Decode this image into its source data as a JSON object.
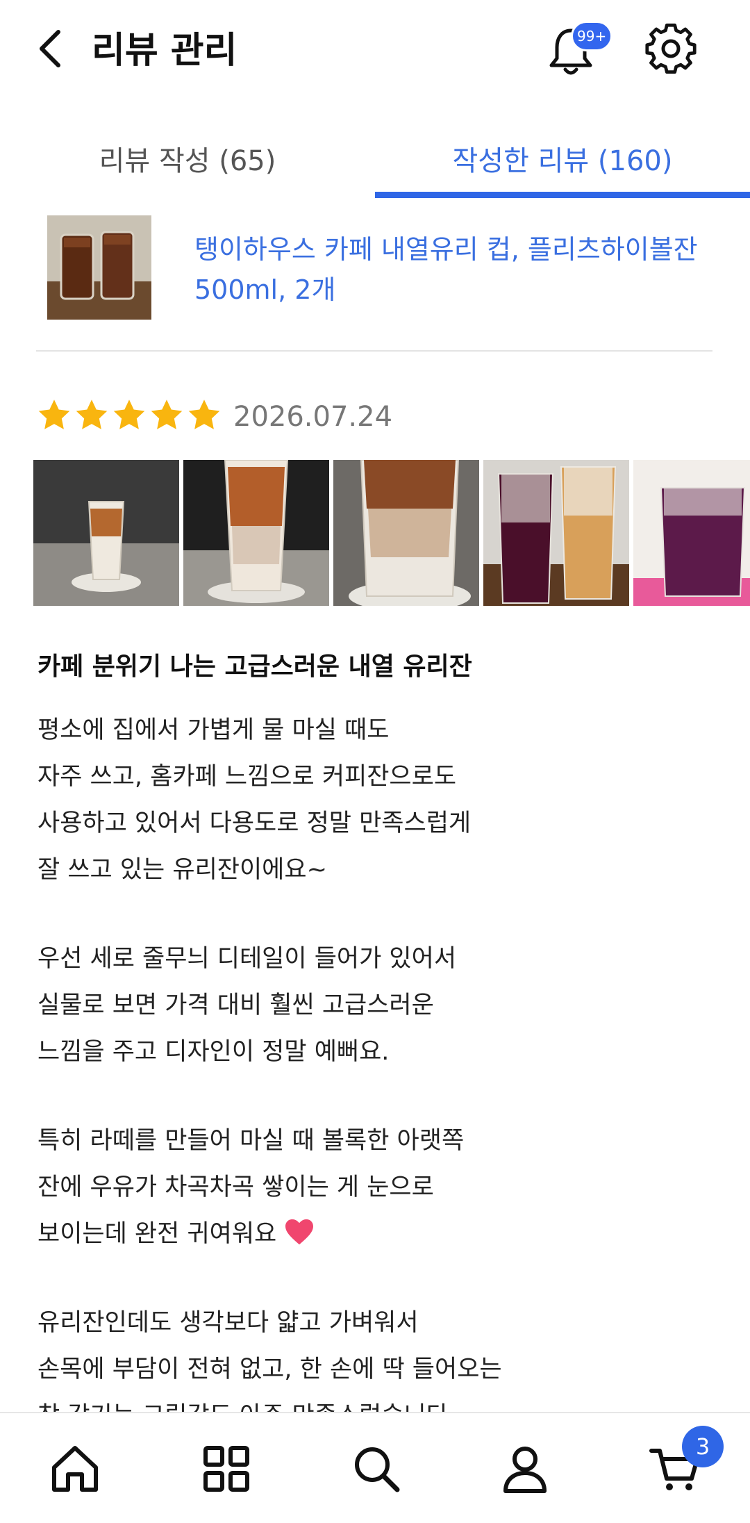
{
  "header": {
    "title": "리뷰 관리",
    "notification_badge": "99+"
  },
  "tabs": [
    {
      "label": "리뷰 작성 (65)",
      "active": false
    },
    {
      "label": "작성한 리뷰 (160)",
      "active": true
    }
  ],
  "product": {
    "name": "탱이하우스 카페 내열유리 컵, 플리츠하이볼잔 500ml, 2개"
  },
  "review": {
    "rating": 5,
    "rating_max": 5,
    "date": "2026.07.24",
    "title": "카페 분위기 나는 고급스러운 내열 유리잔",
    "lines": [
      "평소에 집에서 가볍게 물 마실 때도",
      "자주 쓰고, 홈카페 느낌으로 커피잔으로도",
      "사용하고 있어서 다용도로 정말 만족스럽게",
      "잘 쓰고 있는 유리잔이에요~",
      "",
      "우선 세로 줄무늬 디테일이 들어가 있어서",
      "실물로 보면 가격 대비 훨씬 고급스러운",
      "느낌을 주고 디자인이 정말 예뻐요.",
      "",
      "특히 라떼를 만들어 마실 때 볼록한 아랫쪽",
      "잔에 우유가 차곡차곡 쌓이는 게 눈으로",
      "보이는데 완전 귀여워요",
      "",
      "유리잔인데도 생각보다 얇고 가벼워서",
      "손목에 부담이 전혀 없고, 한 손에 딱 들어오는",
      "착 감기는 그립감도 아주 만족스럽습니다"
    ]
  },
  "bottom_nav": {
    "items": [
      "home-icon",
      "grid-icon",
      "search-icon",
      "user-icon",
      "cart-icon"
    ],
    "cart_badge": "3"
  },
  "colors": {
    "accent": "#2f66e6",
    "star": "#f9b50f",
    "link_text": "#3a6fe0"
  }
}
